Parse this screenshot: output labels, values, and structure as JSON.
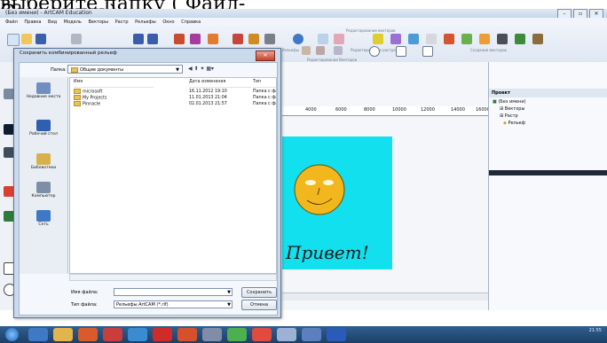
{
  "caption_text": "выберите папку ( Файл-Сохранить)",
  "app": {
    "title": "(Без имени) - ArtCAM Education",
    "menu": [
      "Файл",
      "Правка",
      "Вид",
      "Модель",
      "Векторы",
      "Растр",
      "Рельефы",
      "Окно",
      "Справка"
    ],
    "toolbar_groups": [
      "Редактирование векторов",
      "Создание векторов",
      "Редактирование растра",
      "Рельефы",
      "Редактирование Векторов"
    ]
  },
  "ruler": [
    "4000",
    "6000",
    "8000",
    "10000",
    "12000",
    "14000",
    "16000"
  ],
  "canvas": {
    "background": "#13e0ee",
    "face_color": "#f2b71c",
    "handwriting": "Привет!"
  },
  "project_panel": {
    "header": "Проект",
    "tree": [
      "(Без имени)",
      "Векторы",
      "Растр",
      "Рельеф"
    ]
  },
  "dialog": {
    "title": "Сохранить комбинированный рельеф",
    "folder_label": "Папка:",
    "folder_value": "Общие документы",
    "places": [
      "Недавние места",
      "Рабочий стол",
      "Библиотеки",
      "Компьютер",
      "Сеть"
    ],
    "columns": [
      "Имя",
      "Дата изменения",
      "Тип"
    ],
    "files": [
      {
        "name": "microsoft",
        "date": "16.11.2012 19:10",
        "type": "Папка с фа"
      },
      {
        "name": "My Projects",
        "date": "11.01.2013 21:04",
        "type": "Папка с фа"
      },
      {
        "name": "Pinnacle",
        "date": "02.01.2013 21:57",
        "type": "Папка с фа"
      }
    ],
    "filename_label": "Имя файла:",
    "filename_value": "",
    "filetype_label": "Тип файла:",
    "filetype_value": "Рельефы ArtCAM (*.rlf)",
    "save_label": "Сохранить",
    "cancel_label": "Отмена"
  },
  "taskbar": {
    "time": "21:55"
  }
}
